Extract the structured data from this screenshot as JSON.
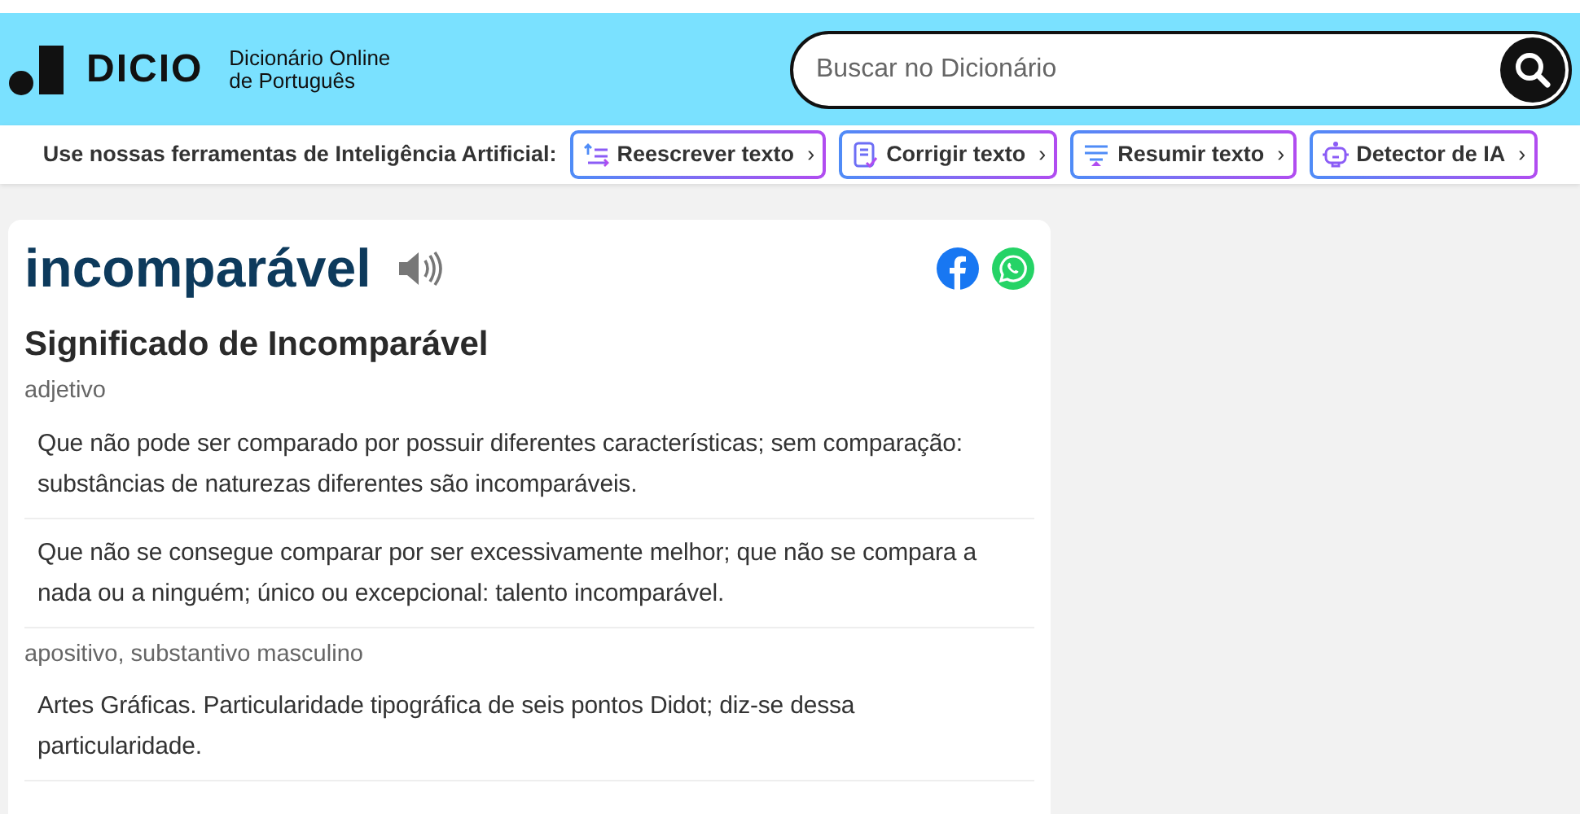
{
  "header": {
    "logo": "DICIO",
    "tagline": [
      "Dicionário Online",
      "de Português"
    ],
    "search": {
      "placeholder": "Buscar no Dicionário"
    }
  },
  "ai_tools": {
    "label": "Use nossas ferramentas de Inteligência Artificial:",
    "tools": [
      {
        "kind": "rewrite",
        "label": "Reescrever texto",
        "arrow": "›"
      },
      {
        "kind": "correct",
        "label": "Corrigir texto",
        "arrow": "›"
      },
      {
        "kind": "summarize",
        "label": "Resumir texto",
        "arrow": "›"
      },
      {
        "kind": "detect",
        "label": "Detector de IA",
        "arrow": "›"
      }
    ]
  },
  "entry": {
    "word": "incomparável",
    "heading": "Significado de Incomparável",
    "groups": [
      {
        "class": "adjetivo",
        "senses": [
          "Que não pode ser comparado por possuir diferentes características; sem comparação: substâncias de naturezas diferentes são incomparáveis.",
          "Que não se consegue comparar por ser excessivamente melhor; que não se compara a nada ou a ninguém; único ou excepcional: talento incomparável."
        ]
      },
      {
        "class": "apositivo, substantivo masculino",
        "senses": [
          "Artes Gráficas. Particularidade tipográfica de seis pontos Didot; diz-se dessa particularidade."
        ]
      }
    ]
  }
}
